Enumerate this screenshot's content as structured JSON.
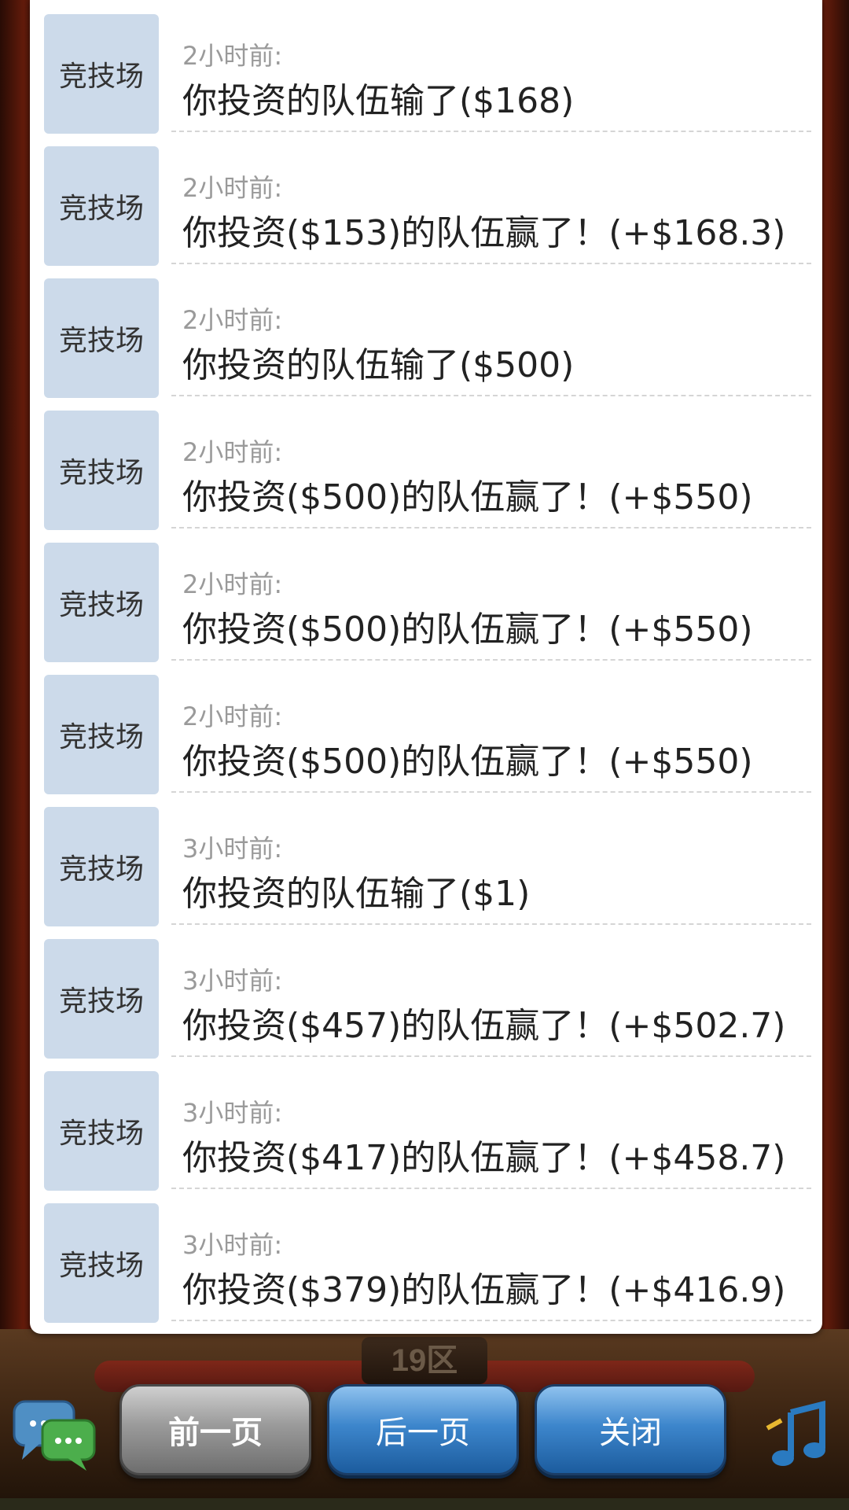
{
  "background": {
    "sign_text": "19区"
  },
  "records": [
    {
      "tag": "竞技场",
      "time": "2小时前:",
      "message": "你投资的队伍输了($168)"
    },
    {
      "tag": "竞技场",
      "time": "2小时前:",
      "message": "你投资($153)的队伍赢了！(+$168.3)"
    },
    {
      "tag": "竞技场",
      "time": "2小时前:",
      "message": "你投资的队伍输了($500)"
    },
    {
      "tag": "竞技场",
      "time": "2小时前:",
      "message": "你投资($500)的队伍赢了！(+$550)"
    },
    {
      "tag": "竞技场",
      "time": "2小时前:",
      "message": "你投资($500)的队伍赢了！(+$550)"
    },
    {
      "tag": "竞技场",
      "time": "2小时前:",
      "message": "你投资($500)的队伍赢了！(+$550)"
    },
    {
      "tag": "竞技场",
      "time": "3小时前:",
      "message": "你投资的队伍输了($1)"
    },
    {
      "tag": "竞技场",
      "time": "3小时前:",
      "message": "你投资($457)的队伍赢了！(+$502.7)"
    },
    {
      "tag": "竞技场",
      "time": "3小时前:",
      "message": "你投资($417)的队伍赢了！(+$458.7)"
    },
    {
      "tag": "竞技场",
      "time": "3小时前:",
      "message": "你投资($379)的队伍赢了！(+$416.9)"
    }
  ],
  "buttons": {
    "prev": "前一页",
    "next": "后一页",
    "close": "关闭"
  },
  "icons": {
    "chat": "chat-bubbles-icon",
    "music": "music-note-icon"
  }
}
